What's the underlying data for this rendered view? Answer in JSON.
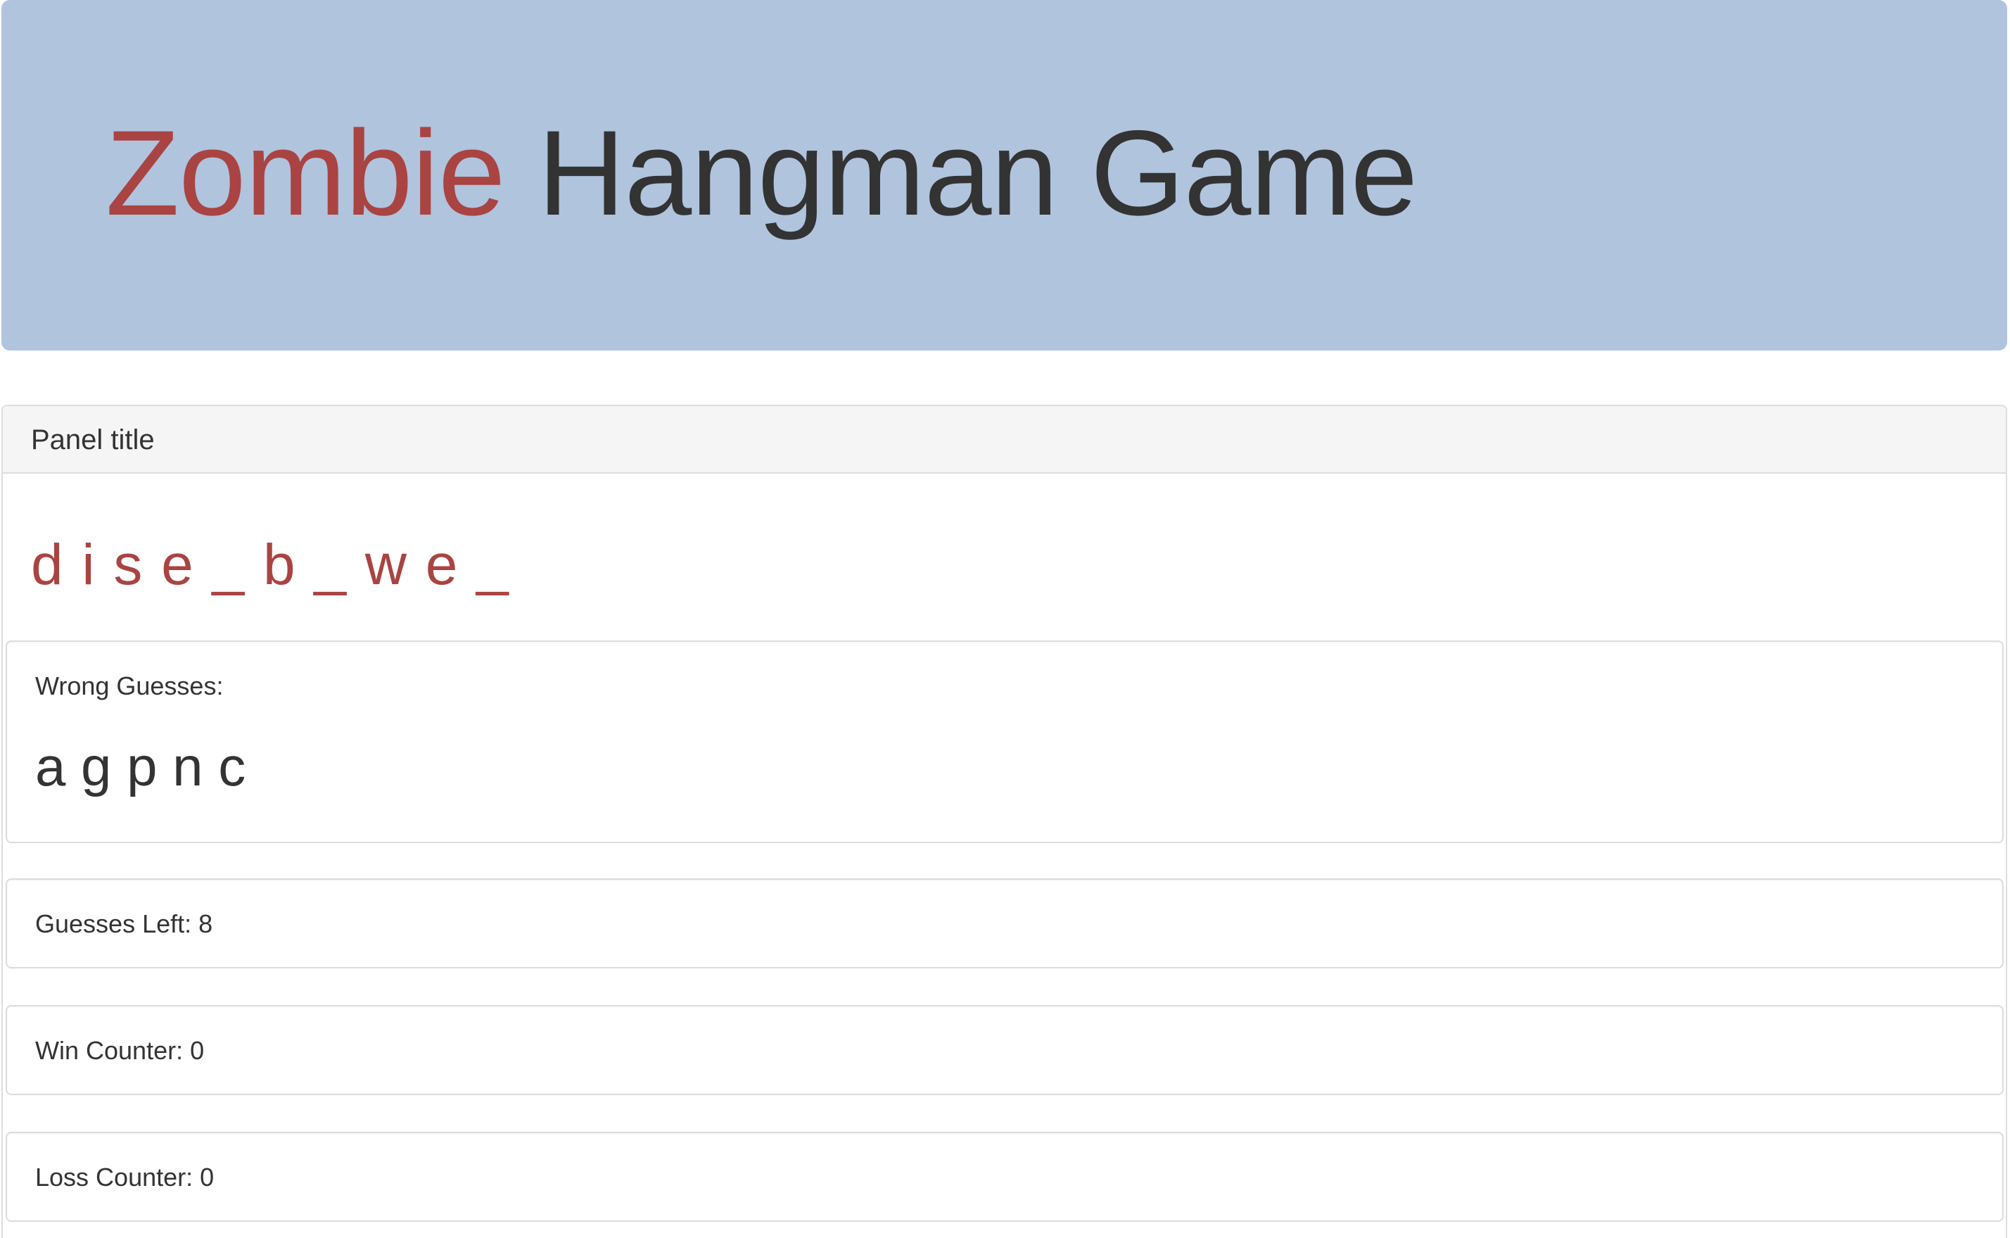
{
  "header": {
    "title_accent": "Zombie",
    "title_rest": "Hangman Game"
  },
  "panel": {
    "title": "Panel title",
    "current_word": "d i s e _ b _ w e _",
    "wrong_guesses": {
      "label": "Wrong Guesses:",
      "letters": "a g p n c"
    },
    "guesses_left": {
      "label": "Guesses Left:",
      "value": "8"
    },
    "win_counter": {
      "label": "Win Counter:",
      "value": "0"
    },
    "loss_counter": {
      "label": "Loss Counter:",
      "value": "0"
    }
  },
  "colors": {
    "header_bg": "#b0c4de",
    "accent": "#a94442",
    "text": "#333333",
    "panel_heading_bg": "#f5f5f5"
  }
}
